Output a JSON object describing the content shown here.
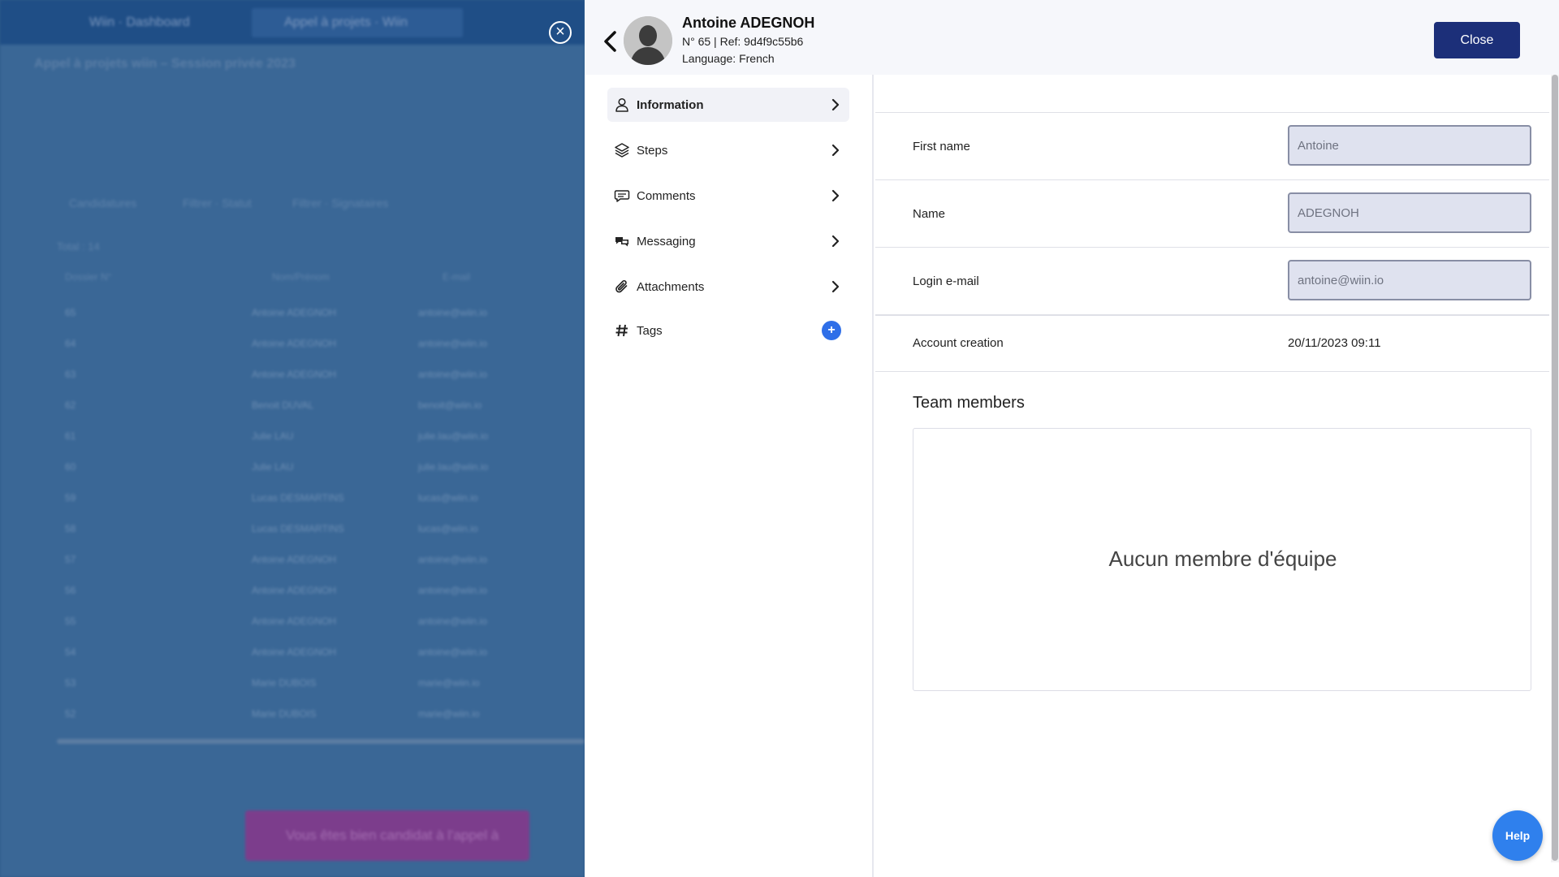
{
  "background": {
    "tabs": [
      "Wiin · Dashboard",
      "Appel à projets · Wiin"
    ],
    "title": "Appel à projets wiin – Session privée 2023",
    "filters": [
      "Candidatures",
      "Filtrer · Statut",
      "Filtrer · Signataires"
    ],
    "count": "Total : 14",
    "headers": [
      "Dossier N°",
      "Nom/Prénom",
      "E-mail"
    ],
    "rows": [
      [
        "65",
        "Antoine ADEGNOH",
        "antoine@wiin.io"
      ],
      [
        "64",
        "Antoine ADEGNOH",
        "antoine@wiin.io"
      ],
      [
        "63",
        "Antoine ADEGNOH",
        "antoine@wiin.io"
      ],
      [
        "62",
        "Benoit DUVAL",
        "benoit@wiin.io"
      ],
      [
        "61",
        "Julie LAU",
        "julie.lau@wiin.io"
      ],
      [
        "60",
        "Julie LAU",
        "julie.lau@wiin.io"
      ],
      [
        "59",
        "Lucas DESMARTINS",
        "lucas@wiin.io"
      ],
      [
        "58",
        "Lucas DESMARTINS",
        "lucas@wiin.io"
      ],
      [
        "57",
        "Antoine ADEGNOH",
        "antoine@wiin.io"
      ],
      [
        "56",
        "Antoine ADEGNOH",
        "antoine@wiin.io"
      ],
      [
        "55",
        "Antoine ADEGNOH",
        "antoine@wiin.io"
      ],
      [
        "54",
        "Antoine ADEGNOH",
        "antoine@wiin.io"
      ],
      [
        "53",
        "Marie DUBOIS",
        "marie@wiin.io"
      ],
      [
        "52",
        "Marie DUBOIS",
        "marie@wiin.io"
      ]
    ],
    "toast": "Vous êtes bien candidat à l'appel à projets"
  },
  "overlay": {
    "close_icon": "×"
  },
  "header": {
    "name": "Antoine ADEGNOH",
    "ref": "N° 65 | Ref: 9d4f9c55b6",
    "language": "Language: French",
    "close_label": "Close"
  },
  "nav": {
    "items": [
      {
        "label": "Information",
        "icon": "user-icon",
        "active": true
      },
      {
        "label": "Steps",
        "icon": "layers-icon"
      },
      {
        "label": "Comments",
        "icon": "comment-icon"
      },
      {
        "label": "Messaging",
        "icon": "messaging-icon"
      },
      {
        "label": "Attachments",
        "icon": "paperclip-icon"
      },
      {
        "label": "Tags",
        "icon": "hashtag-icon",
        "action": "+"
      }
    ]
  },
  "info": {
    "first_name": {
      "label": "First name",
      "value": "Antoine"
    },
    "name": {
      "label": "Name",
      "value": "ADEGNOH"
    },
    "login_email": {
      "label": "Login e-mail",
      "value": "antoine@wiin.io"
    },
    "account_creation": {
      "label": "Account creation",
      "value": "20/11/2023 09:11"
    },
    "team_title": "Team members",
    "team_empty": "Aucun membre d'équipe"
  },
  "help": {
    "label": "Help"
  },
  "colors": {
    "primary": "#1c2f79",
    "accent": "#2f6fe8",
    "help": "#2f80ed",
    "input_bg": "#dfe2ef"
  }
}
